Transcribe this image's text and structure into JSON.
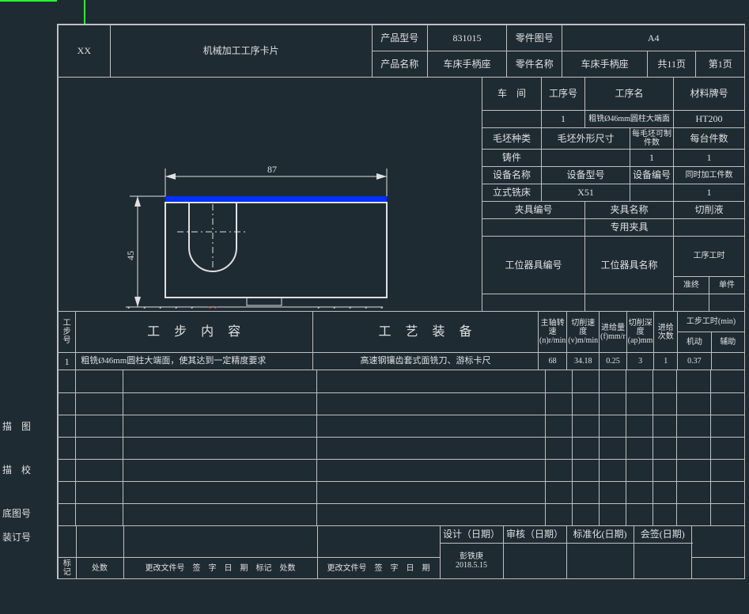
{
  "header": {
    "company": "XX",
    "title": "机械加工工序卡片",
    "product_model_label": "产品型号",
    "product_model": "831015",
    "part_drawing_label": "零件图号",
    "part_drawing": "A4",
    "product_name_label": "产品名称",
    "product_name": "车床手柄座",
    "part_name_label": "零件名称",
    "part_name": "车床手柄座",
    "total_pages": "共11页",
    "page_no": "第1页"
  },
  "info": {
    "workshop_label": "车　间",
    "op_no_label": "工序号",
    "op_name_label": "工序名",
    "material_label": "材料牌号",
    "op_no": "1",
    "op_name": "粗铣Ø46mm圆柱大端面",
    "material": "HT200",
    "blank_type_label": "毛坯种类",
    "blank_dim_label": "毛坯外形尺寸",
    "per_blank_label": "每毛坯可制件数",
    "per_machine_label": "每台件数",
    "blank_type": "铸件",
    "per_blank": "1",
    "per_machine": "1",
    "equip_name_label": "设备名称",
    "equip_model_label": "设备型号",
    "equip_no_label": "设备编号",
    "simul_label": "同时加工件数",
    "equip_name": "立式铣床",
    "equip_model": "X51",
    "simul": "1",
    "fixture_no_label": "夹具编号",
    "fixture_name_label": "夹具名称",
    "coolant_label": "切削液",
    "fixture_name": "专用夹具",
    "station_no_label": "工位器具编号",
    "station_name_label": "工位器具名称",
    "process_time_label": "工序工时",
    "prep_label": "准终",
    "unit_label": "单件"
  },
  "dim": {
    "w": "87",
    "h": "45"
  },
  "cols": {
    "step_no": "工步号",
    "content": "工步内容",
    "tooling": "工艺装备",
    "spindle": "主轴转速(n)r/min",
    "cut_speed": "切削速度(v)m/min",
    "feed": "进给量(f)mm/r",
    "depth": "切削深度(ap)mm",
    "passes": "进给次数",
    "step_time": "工步工时(min)",
    "machine": "机动",
    "aux": "辅助"
  },
  "step": {
    "no": "1",
    "content": "粗铣Ø46mm圆柱大端面，使其达到一定精度要求",
    "tooling": "高速钢镶齿套式面铣刀、游标卡尺",
    "spindle": "68",
    "cut_speed": "34.18",
    "feed": "0.25",
    "depth": "3",
    "passes": "1",
    "machine": "0.37"
  },
  "foot": {
    "design": "设计（日期）",
    "check": "审核（日期）",
    "standard": "标准化(日期)",
    "sign": "会签(日期)",
    "designer": "彭铁庚",
    "date": "2018.5.15",
    "mark": "标记",
    "loc": "处数",
    "change_doc": "更改文件号",
    "signature": "签　字",
    "chg_date": "日　期",
    "drawing": "描　图",
    "proof": "描　校",
    "base_no": "底图号",
    "binding": "装订号"
  }
}
